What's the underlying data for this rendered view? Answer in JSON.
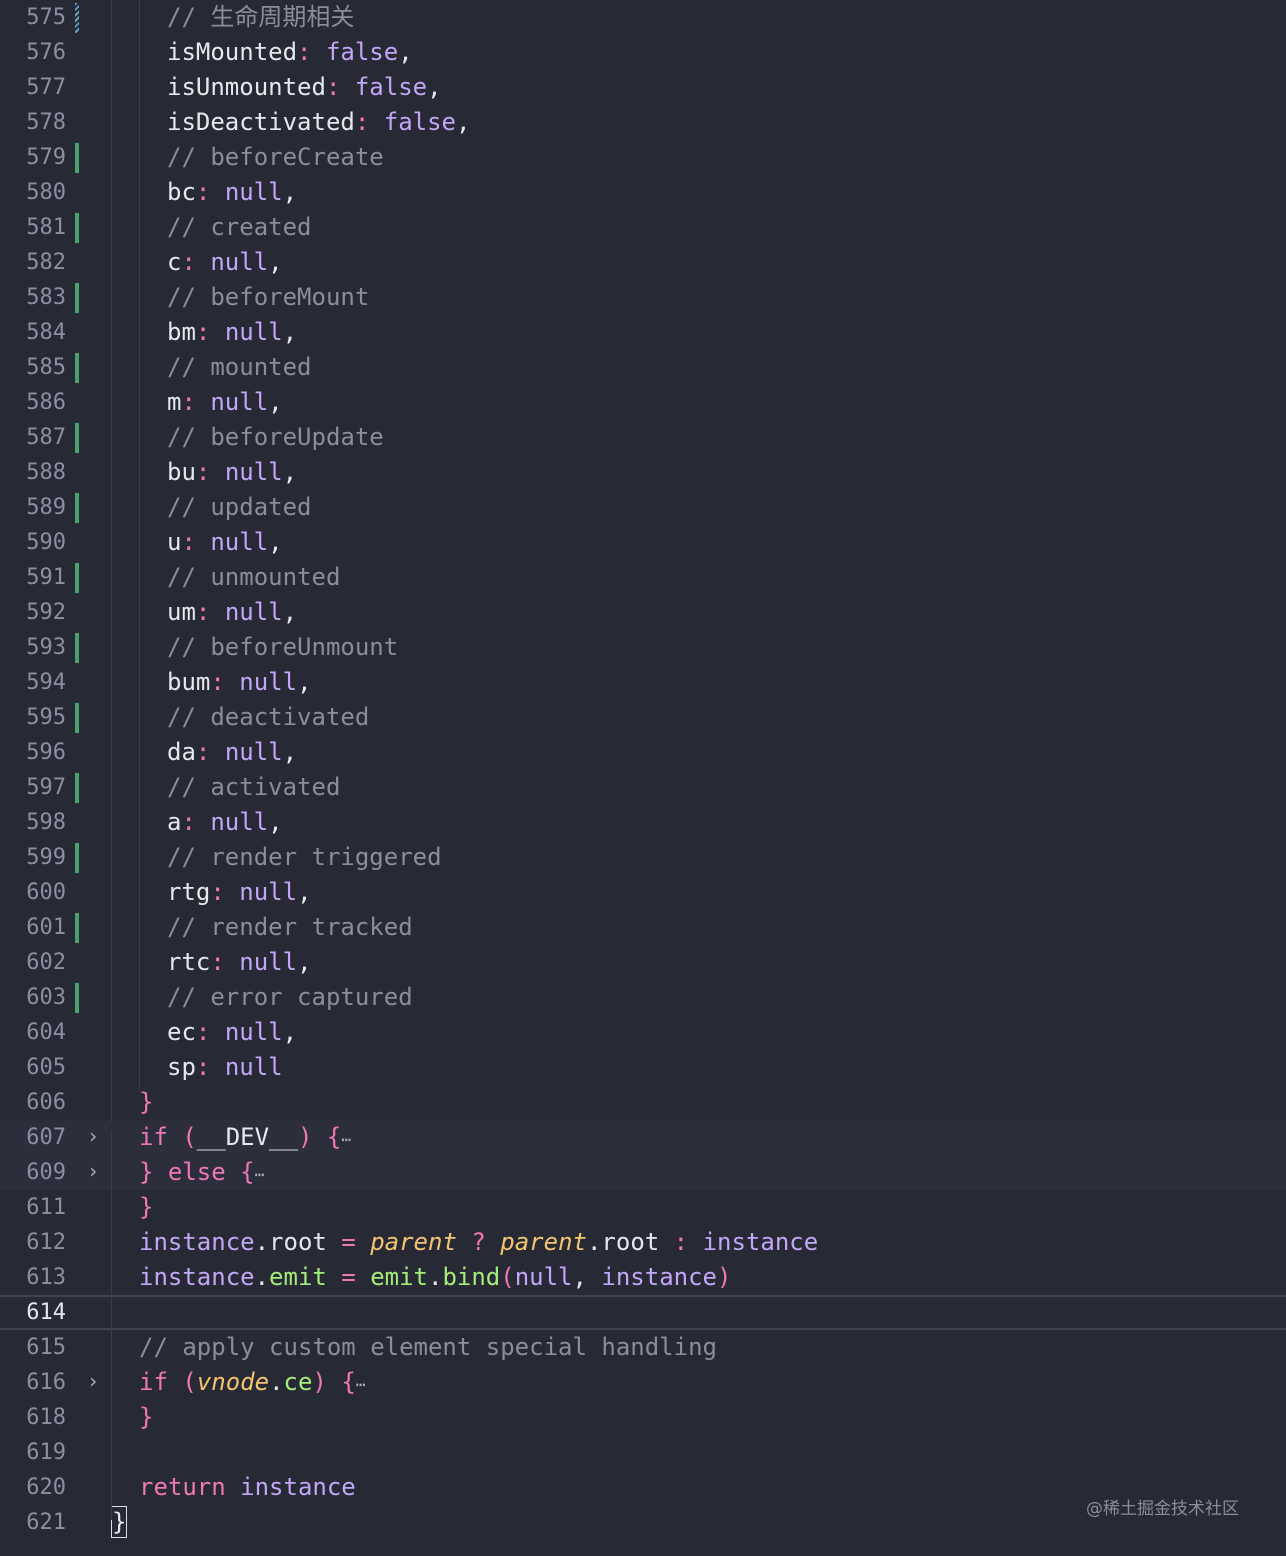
{
  "watermark": "@稀土掘金技术社区",
  "icons": {
    "fold": "chevron-right-icon",
    "ellipsis": "ellipsis-icon"
  },
  "colors": {
    "background": "#272935",
    "keyword": "#ee78b3",
    "literal": "#c3a7f7",
    "comment": "#8a8d9b",
    "function": "#a4ec7a",
    "parameter": "#f4c56f",
    "gutter_added": "#47a36a"
  },
  "lines": [
    {
      "n": "575",
      "gutter": "hatched",
      "indent": 4,
      "tokens": [
        {
          "t": "// 生命周期相关",
          "c": "c"
        }
      ]
    },
    {
      "n": "576",
      "indent": 4,
      "tokens": [
        {
          "t": "isMounted",
          "c": "p"
        },
        {
          "t": ": ",
          "c": "k"
        },
        {
          "t": "false",
          "c": "pu"
        },
        {
          "t": ",",
          "c": "p"
        }
      ]
    },
    {
      "n": "577",
      "indent": 4,
      "tokens": [
        {
          "t": "isUnmounted",
          "c": "p"
        },
        {
          "t": ": ",
          "c": "k"
        },
        {
          "t": "false",
          "c": "pu"
        },
        {
          "t": ",",
          "c": "p"
        }
      ]
    },
    {
      "n": "578",
      "indent": 4,
      "tokens": [
        {
          "t": "isDeactivated",
          "c": "p"
        },
        {
          "t": ": ",
          "c": "k"
        },
        {
          "t": "false",
          "c": "pu"
        },
        {
          "t": ",",
          "c": "p"
        }
      ]
    },
    {
      "n": "579",
      "gutter": "added",
      "indent": 4,
      "tokens": [
        {
          "t": "// beforeCreate",
          "c": "c"
        }
      ]
    },
    {
      "n": "580",
      "indent": 4,
      "tokens": [
        {
          "t": "bc",
          "c": "p"
        },
        {
          "t": ": ",
          "c": "k"
        },
        {
          "t": "null",
          "c": "pu"
        },
        {
          "t": ",",
          "c": "p"
        }
      ]
    },
    {
      "n": "581",
      "gutter": "added",
      "indent": 4,
      "tokens": [
        {
          "t": "// created",
          "c": "c"
        }
      ]
    },
    {
      "n": "582",
      "indent": 4,
      "tokens": [
        {
          "t": "c",
          "c": "p"
        },
        {
          "t": ": ",
          "c": "k"
        },
        {
          "t": "null",
          "c": "pu"
        },
        {
          "t": ",",
          "c": "p"
        }
      ]
    },
    {
      "n": "583",
      "gutter": "added",
      "indent": 4,
      "tokens": [
        {
          "t": "// beforeMount",
          "c": "c"
        }
      ]
    },
    {
      "n": "584",
      "indent": 4,
      "tokens": [
        {
          "t": "bm",
          "c": "p"
        },
        {
          "t": ": ",
          "c": "k"
        },
        {
          "t": "null",
          "c": "pu"
        },
        {
          "t": ",",
          "c": "p"
        }
      ]
    },
    {
      "n": "585",
      "gutter": "added",
      "indent": 4,
      "tokens": [
        {
          "t": "// mounted",
          "c": "c"
        }
      ]
    },
    {
      "n": "586",
      "indent": 4,
      "tokens": [
        {
          "t": "m",
          "c": "p"
        },
        {
          "t": ": ",
          "c": "k"
        },
        {
          "t": "null",
          "c": "pu"
        },
        {
          "t": ",",
          "c": "p"
        }
      ]
    },
    {
      "n": "587",
      "gutter": "added",
      "indent": 4,
      "tokens": [
        {
          "t": "// beforeUpdate",
          "c": "c"
        }
      ]
    },
    {
      "n": "588",
      "indent": 4,
      "tokens": [
        {
          "t": "bu",
          "c": "p"
        },
        {
          "t": ": ",
          "c": "k"
        },
        {
          "t": "null",
          "c": "pu"
        },
        {
          "t": ",",
          "c": "p"
        }
      ]
    },
    {
      "n": "589",
      "gutter": "added",
      "indent": 4,
      "tokens": [
        {
          "t": "// updated",
          "c": "c"
        }
      ]
    },
    {
      "n": "590",
      "indent": 4,
      "tokens": [
        {
          "t": "u",
          "c": "p"
        },
        {
          "t": ": ",
          "c": "k"
        },
        {
          "t": "null",
          "c": "pu"
        },
        {
          "t": ",",
          "c": "p"
        }
      ]
    },
    {
      "n": "591",
      "gutter": "added",
      "indent": 4,
      "tokens": [
        {
          "t": "// unmounted",
          "c": "c"
        }
      ]
    },
    {
      "n": "592",
      "indent": 4,
      "tokens": [
        {
          "t": "um",
          "c": "p"
        },
        {
          "t": ": ",
          "c": "k"
        },
        {
          "t": "null",
          "c": "pu"
        },
        {
          "t": ",",
          "c": "p"
        }
      ]
    },
    {
      "n": "593",
      "gutter": "added",
      "indent": 4,
      "tokens": [
        {
          "t": "// beforeUnmount",
          "c": "c"
        }
      ]
    },
    {
      "n": "594",
      "indent": 4,
      "tokens": [
        {
          "t": "bum",
          "c": "p"
        },
        {
          "t": ": ",
          "c": "k"
        },
        {
          "t": "null",
          "c": "pu"
        },
        {
          "t": ",",
          "c": "p"
        }
      ]
    },
    {
      "n": "595",
      "gutter": "added",
      "indent": 4,
      "tokens": [
        {
          "t": "// deactivated",
          "c": "c"
        }
      ]
    },
    {
      "n": "596",
      "indent": 4,
      "tokens": [
        {
          "t": "da",
          "c": "p"
        },
        {
          "t": ": ",
          "c": "k"
        },
        {
          "t": "null",
          "c": "pu"
        },
        {
          "t": ",",
          "c": "p"
        }
      ]
    },
    {
      "n": "597",
      "gutter": "added",
      "indent": 4,
      "tokens": [
        {
          "t": "// activated",
          "c": "c"
        }
      ]
    },
    {
      "n": "598",
      "indent": 4,
      "tokens": [
        {
          "t": "a",
          "c": "p"
        },
        {
          "t": ": ",
          "c": "k"
        },
        {
          "t": "null",
          "c": "pu"
        },
        {
          "t": ",",
          "c": "p"
        }
      ]
    },
    {
      "n": "599",
      "gutter": "added",
      "indent": 4,
      "tokens": [
        {
          "t": "// render triggered",
          "c": "c"
        }
      ]
    },
    {
      "n": "600",
      "indent": 4,
      "tokens": [
        {
          "t": "rtg",
          "c": "p"
        },
        {
          "t": ": ",
          "c": "k"
        },
        {
          "t": "null",
          "c": "pu"
        },
        {
          "t": ",",
          "c": "p"
        }
      ]
    },
    {
      "n": "601",
      "gutter": "added",
      "indent": 4,
      "tokens": [
        {
          "t": "// render tracked",
          "c": "c"
        }
      ]
    },
    {
      "n": "602",
      "indent": 4,
      "tokens": [
        {
          "t": "rtc",
          "c": "p"
        },
        {
          "t": ": ",
          "c": "k"
        },
        {
          "t": "null",
          "c": "pu"
        },
        {
          "t": ",",
          "c": "p"
        }
      ]
    },
    {
      "n": "603",
      "gutter": "added",
      "indent": 4,
      "tokens": [
        {
          "t": "// error captured",
          "c": "c"
        }
      ]
    },
    {
      "n": "604",
      "indent": 4,
      "tokens": [
        {
          "t": "ec",
          "c": "p"
        },
        {
          "t": ": ",
          "c": "k"
        },
        {
          "t": "null",
          "c": "pu"
        },
        {
          "t": ",",
          "c": "p"
        }
      ]
    },
    {
      "n": "605",
      "indent": 4,
      "tokens": [
        {
          "t": "sp",
          "c": "p"
        },
        {
          "t": ": ",
          "c": "k"
        },
        {
          "t": "null",
          "c": "pu"
        }
      ]
    },
    {
      "n": "606",
      "indent": 2,
      "tokens": [
        {
          "t": "}",
          "c": "k"
        }
      ]
    },
    {
      "n": "607",
      "fold": true,
      "folded": true,
      "indent": 2,
      "tokens": [
        {
          "t": "if",
          "c": "k"
        },
        {
          "t": " (",
          "c": "k"
        },
        {
          "t": "__DEV__",
          "c": "p"
        },
        {
          "t": ") {",
          "c": "k"
        },
        {
          "t": "⋯",
          "c": "dim"
        }
      ]
    },
    {
      "n": "609",
      "fold": true,
      "folded": true,
      "indent": 2,
      "tokens": [
        {
          "t": "} else {",
          "c": "k"
        },
        {
          "t": "⋯",
          "c": "dim"
        }
      ]
    },
    {
      "n": "611",
      "indent": 2,
      "tokens": [
        {
          "t": "}",
          "c": "k"
        }
      ]
    },
    {
      "n": "612",
      "indent": 2,
      "tokens": [
        {
          "t": "instance",
          "c": "pu"
        },
        {
          "t": ".",
          "c": "p"
        },
        {
          "t": "root",
          "c": "p"
        },
        {
          "t": " = ",
          "c": "k"
        },
        {
          "t": "parent",
          "c": "it"
        },
        {
          "t": " ? ",
          "c": "k"
        },
        {
          "t": "parent",
          "c": "it"
        },
        {
          "t": ".",
          "c": "p"
        },
        {
          "t": "root",
          "c": "p"
        },
        {
          "t": " : ",
          "c": "k"
        },
        {
          "t": "instance",
          "c": "pu"
        }
      ]
    },
    {
      "n": "613",
      "indent": 2,
      "tokens": [
        {
          "t": "instance",
          "c": "pu"
        },
        {
          "t": ".",
          "c": "p"
        },
        {
          "t": "emit",
          "c": "fn"
        },
        {
          "t": " = ",
          "c": "k"
        },
        {
          "t": "emit",
          "c": "fn"
        },
        {
          "t": ".",
          "c": "p"
        },
        {
          "t": "bind",
          "c": "fn"
        },
        {
          "t": "(",
          "c": "k"
        },
        {
          "t": "null",
          "c": "pu"
        },
        {
          "t": ", ",
          "c": "p"
        },
        {
          "t": "instance",
          "c": "pu"
        },
        {
          "t": ")",
          "c": "k"
        }
      ]
    },
    {
      "n": "614",
      "current": true,
      "indent": 0,
      "tokens": []
    },
    {
      "n": "615",
      "indent": 2,
      "tokens": [
        {
          "t": "// apply custom element special handling",
          "c": "c"
        }
      ]
    },
    {
      "n": "616",
      "fold": true,
      "indent": 2,
      "tokens": [
        {
          "t": "if",
          "c": "k"
        },
        {
          "t": " (",
          "c": "k"
        },
        {
          "t": "vnode",
          "c": "it"
        },
        {
          "t": ".",
          "c": "p"
        },
        {
          "t": "ce",
          "c": "fn"
        },
        {
          "t": ") {",
          "c": "k"
        },
        {
          "t": "⋯",
          "c": "dim"
        }
      ]
    },
    {
      "n": "618",
      "indent": 2,
      "tokens": [
        {
          "t": "}",
          "c": "k"
        }
      ]
    },
    {
      "n": "619",
      "indent": 0,
      "tokens": []
    },
    {
      "n": "620",
      "indent": 2,
      "tokens": [
        {
          "t": "return",
          "c": "k"
        },
        {
          "t": " ",
          "c": "p"
        },
        {
          "t": "instance",
          "c": "pu"
        }
      ]
    },
    {
      "n": "621",
      "indent": 0,
      "tokens": [
        {
          "t": "}",
          "c": "cursor"
        }
      ]
    }
  ]
}
